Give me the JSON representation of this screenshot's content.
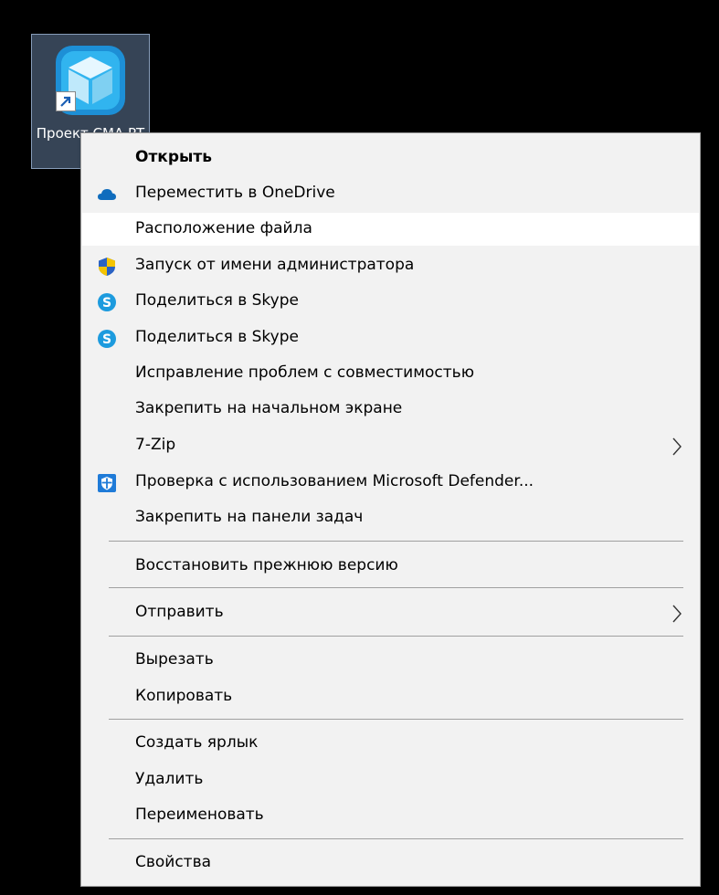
{
  "desktop": {
    "shortcut_label": "Проект СМА РТ"
  },
  "menu": {
    "items": [
      {
        "label": "Открыть",
        "icon": "none"
      },
      {
        "label": "Переместить в OneDrive",
        "icon": "onedrive-cloud-icon"
      },
      {
        "label": "Расположение файла",
        "icon": "none"
      },
      {
        "label": "Запуск от имени администратора",
        "icon": "uac-shield-icon"
      },
      {
        "label": "Поделиться в Skype",
        "icon": "skype-icon"
      },
      {
        "label": "Поделиться в Skype",
        "icon": "skype-icon"
      },
      {
        "label": "Исправление проблем с совместимостью",
        "icon": "none"
      },
      {
        "label": "Закрепить на начальном экране",
        "icon": "none"
      },
      {
        "label": "7-Zip",
        "icon": "none"
      },
      {
        "label": "Проверка с использованием Microsoft Defender...",
        "icon": "defender-shield-icon"
      },
      {
        "label": "Закрепить на панели задач",
        "icon": "none"
      },
      {
        "label": "Восстановить прежнюю версию",
        "icon": "none"
      },
      {
        "label": "Отправить",
        "icon": "none"
      },
      {
        "label": "Вырезать",
        "icon": "none"
      },
      {
        "label": "Копировать",
        "icon": "none"
      },
      {
        "label": "Создать ярлык",
        "icon": "none"
      },
      {
        "label": "Удалить",
        "icon": "none"
      },
      {
        "label": "Переименовать",
        "icon": "none"
      },
      {
        "label": "Свойства",
        "icon": "none"
      }
    ],
    "highlighted_item": "Расположение файла"
  },
  "colors": {
    "menu_background": "#f2f2f2",
    "highlight": "#ffffff",
    "onedrive": "#0f6cbd",
    "skype": "#1d9bde",
    "defender": "#1f7bd8"
  }
}
